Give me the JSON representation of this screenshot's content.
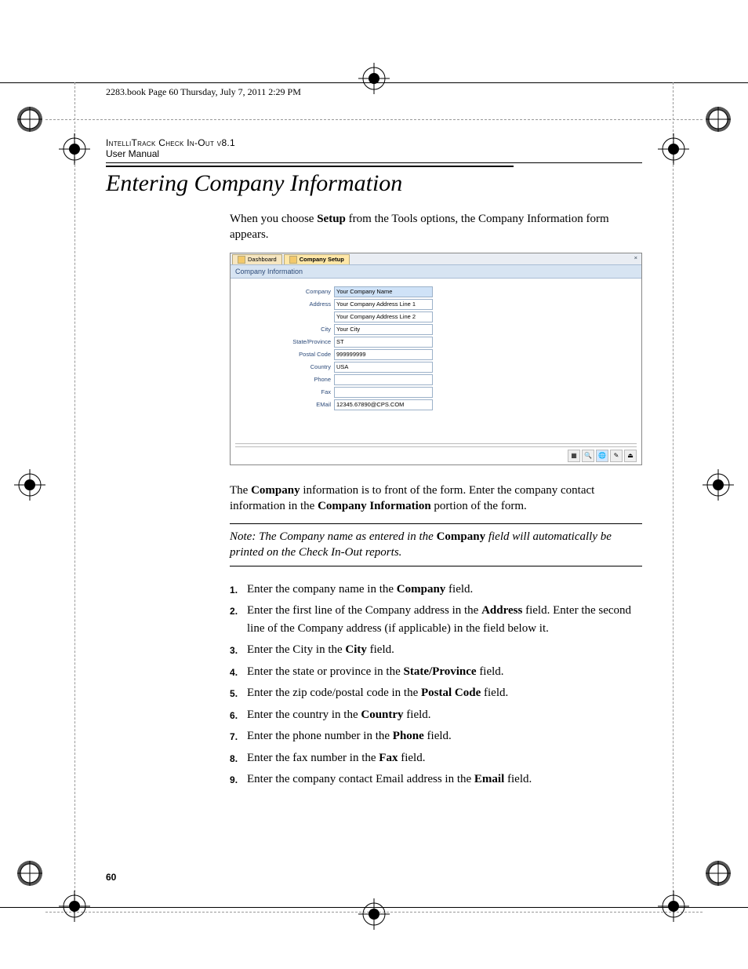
{
  "book_header": "2283.book  Page 60  Thursday, July 7, 2011  2:29 PM",
  "running_head": {
    "line1": "IntelliTrack Check In-Out v8.1",
    "line2": "User Manual"
  },
  "section_title": "Entering Company Information",
  "intro": {
    "pre": "When you choose ",
    "bold": "Setup",
    "post": " from the Tools options, the Company Information form appears."
  },
  "screenshot": {
    "tabs": {
      "dashboard": "Dashboard",
      "company_setup": "Company Setup",
      "close": "×"
    },
    "title": "Company Information",
    "fields": {
      "company": {
        "label": "Company",
        "value": "Your Company Name"
      },
      "address1": {
        "label": "Address",
        "value": "Your Company Address Line 1"
      },
      "address2": {
        "label": "",
        "value": "Your Company Address Line 2"
      },
      "city": {
        "label": "City",
        "value": "Your City"
      },
      "state": {
        "label": "State/Province",
        "value": "ST"
      },
      "postal": {
        "label": "Postal Code",
        "value": "999999999"
      },
      "country": {
        "label": "Country",
        "value": "USA"
      },
      "phone": {
        "label": "Phone",
        "value": ""
      },
      "fax": {
        "label": "Fax",
        "value": ""
      },
      "email": {
        "label": "EMail",
        "value": "12345.67890@CPS.COM"
      }
    }
  },
  "para2": {
    "p1": "The ",
    "b1": "Company",
    "p2": " information is to front of the form. Enter the company contact information in the ",
    "b2": "Company Information",
    "p3": " portion of the form."
  },
  "note": {
    "prefix": "Note:   The Company name as entered in the ",
    "bold": "Company",
    "suffix": " field will automatically be printed on the Check In-Out reports."
  },
  "steps": [
    {
      "pre": "Enter the company name in the ",
      "b": "Company",
      "post": " field."
    },
    {
      "pre": "Enter the first line of the Company address in the ",
      "b": "Address",
      "post": " field. Enter the second line of the Company address (if applicable) in the field below it."
    },
    {
      "pre": "Enter the City in the ",
      "b": "City",
      "post": " field."
    },
    {
      "pre": "Enter the state or province in the ",
      "b": "State/Province",
      "post": " field."
    },
    {
      "pre": "Enter the zip code/postal code in the ",
      "b": "Postal Code",
      "post": " field."
    },
    {
      "pre": "Enter the country in the ",
      "b": "Country",
      "post": " field."
    },
    {
      "pre": "Enter the phone number in the ",
      "b": "Phone",
      "post": " field."
    },
    {
      "pre": "Enter the fax number in the ",
      "b": "Fax",
      "post": " field."
    },
    {
      "pre": "Enter the company contact Email address in the ",
      "b": "Email",
      "post": " field."
    }
  ],
  "page_number": "60"
}
